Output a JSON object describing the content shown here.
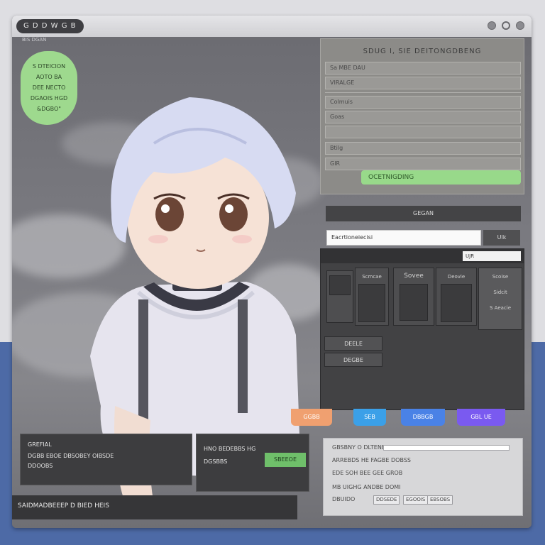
{
  "window": {
    "title": "G D D W G B",
    "caption": "BIS DGAN"
  },
  "speech_bubble": {
    "lines": [
      "S DTEICION",
      "AOTO BA",
      "DEE NECTO",
      "DGAOIS HGD",
      "&DGBO\""
    ]
  },
  "form": {
    "title": "SDUG I, SIE DEITONGDBENG",
    "fields": [
      "Sa MBE DAU",
      "VIRALGE",
      "Colmuis",
      "Goas",
      "",
      "Btilg",
      "GIR"
    ],
    "green_button": "OCETNIGDING",
    "dark_bar": "GEGAN",
    "input_value": "Eacrtioneiecisi",
    "input_button": "Ulk"
  },
  "dark_window": {
    "search_value": "UJR",
    "tiles": [
      "Scmcae",
      "Sovee",
      "Deovie",
      "Scoise"
    ],
    "side_labels": [
      "Sidcit",
      "S Aeacie"
    ],
    "buttons": [
      "DEELE",
      "DEGBE"
    ]
  },
  "color_tabs": [
    {
      "label": "GGBB",
      "color": "#f0a070"
    },
    {
      "label": "SEB",
      "color": "#3ba0e8"
    },
    {
      "label": "DBBGB",
      "color": "#4a82e6"
    },
    {
      "label": "GBL UE",
      "color": "#7a5af0"
    }
  ],
  "bottom_left": {
    "panel1": [
      "GREFIAL",
      "DGBB EBOE DBSOBEY OIBSDE",
      "DDOOBS"
    ],
    "panel2": {
      "title": "HNO BEDEBBS HG",
      "body": "DGSBBS",
      "green_button": "SBEEOE"
    },
    "chat_bar": "SAIDMADBEEEP D BIED HEIS"
  },
  "bottom_right": {
    "lines": [
      "GBSBNY O DLTENETB",
      "ARREBDS HE FAGBE DOBSS",
      "EDE SOH BEE GEE GROB",
      "MB UIGHG ANDBE DOMI"
    ],
    "footer_label": "DBUIDO",
    "chips": [
      "DDSEDE",
      "EGOOIS",
      "EBSOBS"
    ]
  },
  "colors": {
    "accent_green": "#98d98a",
    "desktop_blue": "#4d6aa6"
  }
}
